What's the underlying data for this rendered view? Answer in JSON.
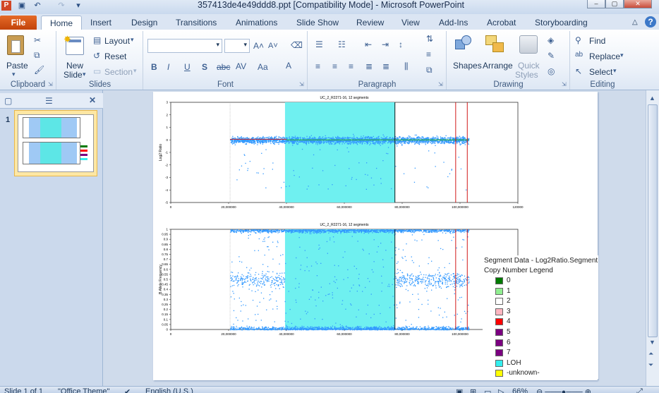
{
  "window": {
    "title": "357413de4e49ddd8.ppt [Compatibility Mode]  -  Microsoft PowerPoint"
  },
  "tabs": [
    {
      "label": "File"
    },
    {
      "label": "Home"
    },
    {
      "label": "Insert"
    },
    {
      "label": "Design"
    },
    {
      "label": "Transitions"
    },
    {
      "label": "Animations"
    },
    {
      "label": "Slide Show"
    },
    {
      "label": "Review"
    },
    {
      "label": "View"
    },
    {
      "label": "Add-Ins"
    },
    {
      "label": "Acrobat"
    },
    {
      "label": "Storyboarding"
    }
  ],
  "ribbon": {
    "clipboard": {
      "label": "Clipboard",
      "paste": "Paste"
    },
    "slides": {
      "label": "Slides",
      "new_slide_1": "New",
      "new_slide_2": "Slide",
      "layout": "Layout",
      "reset": "Reset",
      "section": "Section"
    },
    "font": {
      "label": "Font"
    },
    "paragraph": {
      "label": "Paragraph"
    },
    "drawing": {
      "label": "Drawing",
      "shapes": "Shapes",
      "arrange": "Arrange",
      "quick_styles_1": "Quick",
      "quick_styles_2": "Styles"
    },
    "editing": {
      "label": "Editing",
      "find": "Find",
      "replace": "Replace",
      "select": "Select"
    }
  },
  "left_panel": {
    "slide_number": "1"
  },
  "statusbar": {
    "slide_info": "Slide 1 of 1",
    "theme": "\"Office Theme\"",
    "language": "English (U.S.)",
    "zoom": "66%"
  },
  "slide": {
    "legend": {
      "title_1": "Segment Data - Log2Ratio.Segment",
      "title_2": "Copy Number Legend",
      "items": [
        {
          "label": "0",
          "color": "#007a00"
        },
        {
          "label": "1",
          "color": "#90ee90"
        },
        {
          "label": "2",
          "color": "#ffffff"
        },
        {
          "label": "3",
          "color": "#ffb6c1"
        },
        {
          "label": "4",
          "color": "#ff0000"
        },
        {
          "label": "5",
          "color": "#7b0080"
        },
        {
          "label": "6",
          "color": "#7b0080"
        },
        {
          "label": "7",
          "color": "#7b0080"
        },
        {
          "label": "LOH",
          "color": "#33eeee"
        },
        {
          "label": "-unknown-",
          "color": "#ffff00"
        }
      ]
    }
  },
  "chart_data": [
    {
      "type": "scatter",
      "title": "UC_2_R2271-16, 12 segments",
      "ylabel": "Log2 Ratio",
      "xlim": [
        0,
        120000000
      ],
      "ylim": [
        -5,
        3
      ],
      "x_ticks": [
        "0",
        "20,000000",
        "40,000000",
        "60,000000",
        "80,000000",
        "100,000000",
        "120000"
      ],
      "y_ticks": [
        "3",
        "2",
        "1",
        "0",
        "-1",
        "-2",
        "-3",
        "-4",
        "-5"
      ],
      "data_range": [
        20500000,
        103000000
      ],
      "band_center": 0,
      "loh_regions": [
        [
          39500000,
          77500000
        ]
      ],
      "segments": [
        {
          "start": 20500000,
          "end": 40000000,
          "value": 0.05,
          "color": "#cc2222"
        },
        {
          "start": 40000000,
          "end": 103000000,
          "value": 0.0,
          "color": "#22aa22"
        }
      ],
      "markers": [
        {
          "x": 77500000,
          "color": "#000000"
        },
        {
          "x": 98500000,
          "color": "#cc0000"
        },
        {
          "x": 102500000,
          "color": "#cc0000"
        }
      ],
      "series_color": "#3399ff"
    },
    {
      "type": "scatter",
      "title": "UC_2_R2271-16, 12 segments",
      "ylabel": "B Allele Frequency",
      "xlim": [
        0,
        120000000
      ],
      "ylim": [
        0,
        1
      ],
      "x_ticks": [
        "0",
        "20,000000",
        "40,000000",
        "60,000000",
        "80,000000",
        "100,000000",
        "120000"
      ],
      "y_ticks": [
        "1",
        "0.95",
        "0.9",
        "0.85",
        "0.8",
        "0.75",
        "0.7",
        "0.65",
        "0.6",
        "0.55",
        "0.5",
        "0.45",
        "0.4",
        "0.35",
        "0.3",
        "0.25",
        "0.2",
        "0.15",
        "0.1",
        "0.05",
        "0"
      ],
      "data_range": [
        20500000,
        103000000
      ],
      "loh_regions": [
        [
          39500000,
          77500000
        ]
      ],
      "markers": [
        {
          "x": 77500000,
          "color": "#000000"
        },
        {
          "x": 98500000,
          "color": "#cc0000"
        },
        {
          "x": 102500000,
          "color": "#cc0000"
        }
      ],
      "series_color": "#3399ff"
    }
  ]
}
